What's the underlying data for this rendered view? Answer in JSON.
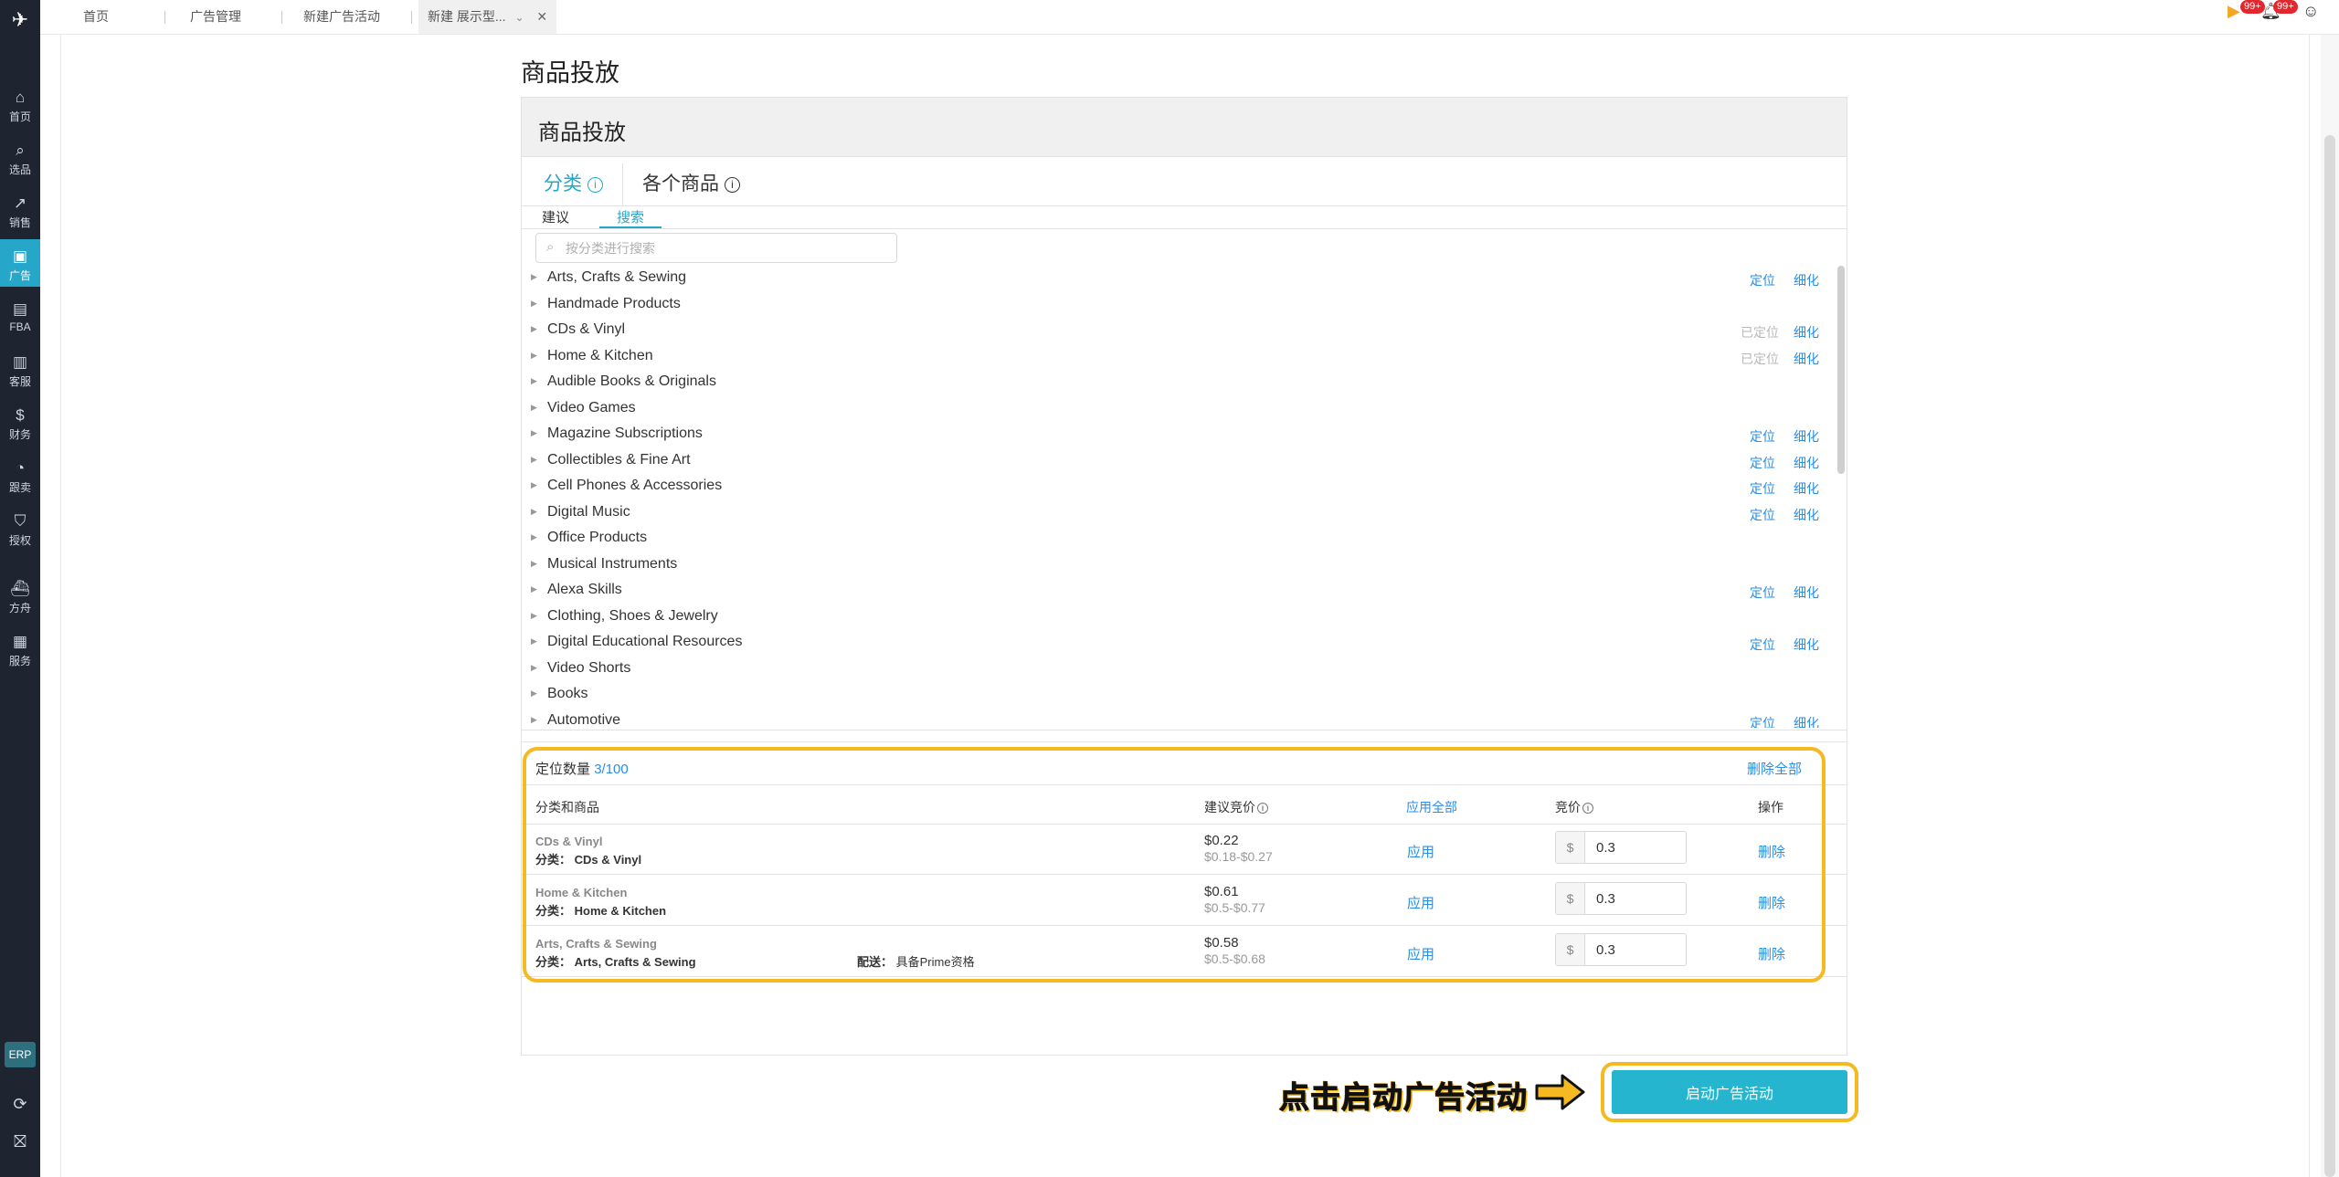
{
  "sidebar": {
    "items": [
      {
        "label": "首页",
        "icon": "home-icon",
        "glyph": "⌂"
      },
      {
        "label": "选品",
        "icon": "search-icon",
        "glyph": "⌕"
      },
      {
        "label": "销售",
        "icon": "chart-line-icon",
        "glyph": "↗"
      },
      {
        "label": "广告",
        "icon": "ad-icon",
        "glyph": "▣"
      },
      {
        "label": "FBA",
        "icon": "box-icon",
        "glyph": "▤"
      },
      {
        "label": "客服",
        "icon": "bar-chart-icon",
        "glyph": "▥"
      },
      {
        "label": "财务",
        "icon": "dollar-icon",
        "glyph": "$"
      },
      {
        "label": "跟卖",
        "icon": "pie-chart-icon",
        "glyph": "◔"
      },
      {
        "label": "授权",
        "icon": "shield-icon",
        "glyph": "⛉"
      },
      {
        "label": "方舟",
        "icon": "ship-icon",
        "glyph": "⛴"
      },
      {
        "label": "服务",
        "icon": "building-icon",
        "glyph": "▦"
      }
    ],
    "erp_label": "ERP"
  },
  "tabs": [
    {
      "label": "首页"
    },
    {
      "label": "广告管理"
    },
    {
      "label": "新建广告活动"
    },
    {
      "label": "新建 展示型..."
    }
  ],
  "notifications": {
    "flag_count": "99+",
    "bell_count": "99+"
  },
  "page": {
    "title": "商品投放"
  },
  "panel": {
    "header": "商品投放",
    "type_tabs": [
      "分类",
      "各个商品"
    ],
    "sub_tabs": [
      "建议",
      "搜索"
    ],
    "search_placeholder": "按分类进行搜索",
    "categories": [
      {
        "name": "Arts, Crafts & Sewing",
        "locate": "定位",
        "refine": "细化",
        "located": false
      },
      {
        "name": "Handmade Products",
        "locate": "",
        "refine": "",
        "located": false
      },
      {
        "name": "CDs & Vinyl",
        "locate": "已定位",
        "refine": "细化",
        "located": true
      },
      {
        "name": "Home & Kitchen",
        "locate": "已定位",
        "refine": "细化",
        "located": true
      },
      {
        "name": "Audible Books & Originals",
        "locate": "",
        "refine": "",
        "located": false
      },
      {
        "name": "Video Games",
        "locate": "",
        "refine": "",
        "located": false
      },
      {
        "name": "Magazine Subscriptions",
        "locate": "定位",
        "refine": "细化",
        "located": false
      },
      {
        "name": "Collectibles & Fine Art",
        "locate": "定位",
        "refine": "细化",
        "located": false
      },
      {
        "name": "Cell Phones & Accessories",
        "locate": "定位",
        "refine": "细化",
        "located": false
      },
      {
        "name": "Digital Music",
        "locate": "定位",
        "refine": "细化",
        "located": false
      },
      {
        "name": "Office Products",
        "locate": "",
        "refine": "",
        "located": false
      },
      {
        "name": "Musical Instruments",
        "locate": "",
        "refine": "",
        "located": false
      },
      {
        "name": "Alexa Skills",
        "locate": "定位",
        "refine": "细化",
        "located": false
      },
      {
        "name": "Clothing, Shoes & Jewelry",
        "locate": "",
        "refine": "",
        "located": false
      },
      {
        "name": "Digital Educational Resources",
        "locate": "定位",
        "refine": "细化",
        "located": false
      },
      {
        "name": "Video Shorts",
        "locate": "",
        "refine": "",
        "located": false
      },
      {
        "name": "Books",
        "locate": "",
        "refine": "",
        "located": false
      },
      {
        "name": "Automotive",
        "locate": "定位",
        "refine": "细化",
        "located": false
      }
    ]
  },
  "selected": {
    "count_label": "定位数量",
    "count_value": "3/100",
    "delete_all": "删除全部",
    "headers": {
      "category_product": "分类和商品",
      "suggested_bid": "建议竞价",
      "apply_all": "应用全部",
      "bid": "竞价",
      "action": "操作"
    },
    "rows": [
      {
        "name": "CDs & Vinyl",
        "cat_label": "分类：",
        "cat": "CDs & Vinyl",
        "ship_label": "",
        "ship": "",
        "bid": "$0.22",
        "range": "$0.18-$0.27",
        "apply": "应用",
        "currency": "$",
        "value": "0.3",
        "delete": "删除"
      },
      {
        "name": "Home & Kitchen",
        "cat_label": "分类：",
        "cat": "Home & Kitchen",
        "ship_label": "",
        "ship": "",
        "bid": "$0.61",
        "range": "$0.5-$0.77",
        "apply": "应用",
        "currency": "$",
        "value": "0.3",
        "delete": "删除"
      },
      {
        "name": "Arts, Crafts & Sewing",
        "cat_label": "分类：",
        "cat": "Arts, Crafts & Sewing",
        "ship_label": "配送：",
        "ship": "具备Prime资格",
        "bid": "$0.58",
        "range": "$0.5-$0.68",
        "apply": "应用",
        "currency": "$",
        "value": "0.3",
        "delete": "删除"
      }
    ]
  },
  "callout": {
    "text": "点击启动广告活动"
  },
  "launch_button": "启动广告活动",
  "colors": {
    "accent": "#26a7c9",
    "link": "#2a8ee6",
    "highlight": "#f5b921",
    "sidebar": "#1e2530"
  }
}
